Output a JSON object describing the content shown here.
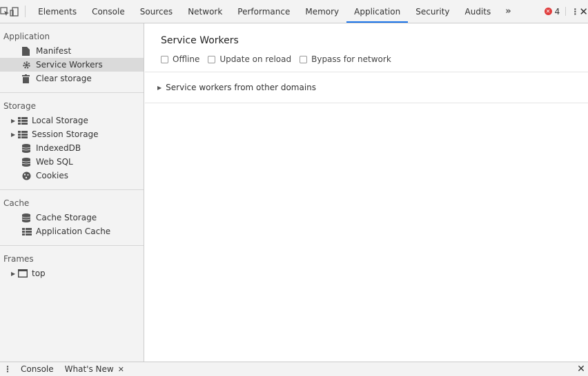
{
  "toolbar": {
    "tabs": [
      {
        "label": "Elements",
        "active": false
      },
      {
        "label": "Console",
        "active": false
      },
      {
        "label": "Sources",
        "active": false
      },
      {
        "label": "Network",
        "active": false
      },
      {
        "label": "Performance",
        "active": false
      },
      {
        "label": "Memory",
        "active": false
      },
      {
        "label": "Application",
        "active": true
      },
      {
        "label": "Security",
        "active": false
      },
      {
        "label": "Audits",
        "active": false
      }
    ],
    "more_label": "»",
    "error_count": "4",
    "accent": "#1a73e8"
  },
  "sidebar": {
    "application": {
      "title": "Application",
      "items": [
        {
          "label": "Manifest",
          "icon": "file-icon"
        },
        {
          "label": "Service Workers",
          "icon": "gear-icon",
          "selected": true
        },
        {
          "label": "Clear storage",
          "icon": "trash-icon"
        }
      ]
    },
    "storage": {
      "title": "Storage",
      "items": [
        {
          "label": "Local Storage",
          "icon": "grid-icon",
          "expandable": true
        },
        {
          "label": "Session Storage",
          "icon": "grid-icon",
          "expandable": true
        },
        {
          "label": "IndexedDB",
          "icon": "database-icon"
        },
        {
          "label": "Web SQL",
          "icon": "database-icon"
        },
        {
          "label": "Cookies",
          "icon": "cookie-icon"
        }
      ]
    },
    "cache": {
      "title": "Cache",
      "items": [
        {
          "label": "Cache Storage",
          "icon": "database-icon"
        },
        {
          "label": "Application Cache",
          "icon": "grid-icon"
        }
      ]
    },
    "frames": {
      "title": "Frames",
      "items": [
        {
          "label": "top",
          "icon": "frame-icon",
          "expandable": true
        }
      ]
    }
  },
  "main": {
    "title": "Service Workers",
    "options": [
      {
        "label": "Offline",
        "checked": false
      },
      {
        "label": "Update on reload",
        "checked": false
      },
      {
        "label": "Bypass for network",
        "checked": false
      }
    ],
    "other_domains": "Service workers from other domains"
  },
  "drawer": {
    "tabs": [
      {
        "label": "Console",
        "closable": false
      },
      {
        "label": "What's New",
        "closable": true
      }
    ]
  }
}
